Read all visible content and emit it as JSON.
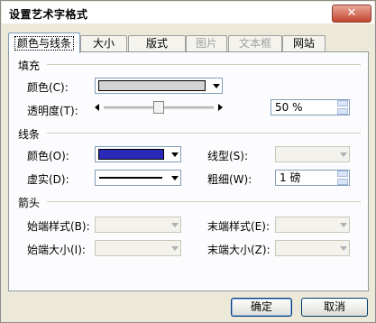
{
  "window": {
    "title": "设置艺术字格式",
    "close_label": "✕"
  },
  "tabs": [
    {
      "label": "颜色与线条",
      "state": "active"
    },
    {
      "label": "大小",
      "state": "normal"
    },
    {
      "label": "版式",
      "state": "normal"
    },
    {
      "label": "图片",
      "state": "disabled"
    },
    {
      "label": "文本框",
      "state": "disabled"
    },
    {
      "label": "网站",
      "state": "normal"
    }
  ],
  "fill": {
    "heading": "填充",
    "color_label": "颜色(C):",
    "color_value": "#d4d4d4",
    "transparency_label": "透明度(T):",
    "transparency_value": "50 %",
    "transparency_fraction": 0.5
  },
  "line": {
    "heading": "线条",
    "color_label": "颜色(O):",
    "color_value": "#2a2ab8",
    "dashed_label": "虚实(D):",
    "style_label": "线型(S):",
    "weight_label": "粗细(W):",
    "weight_value": "1 磅"
  },
  "arrows": {
    "heading": "箭头",
    "begin_style_label": "始端样式(B):",
    "end_style_label": "末端样式(E):",
    "begin_size_label": "始端大小(I):",
    "end_size_label": "末端大小(Z):"
  },
  "buttons": {
    "ok": "确定",
    "cancel": "取消"
  },
  "colors": {
    "dialog_bg": "#ece9d8",
    "panel_bg": "#fcfcfe",
    "accent_border": "#7f9db9"
  }
}
